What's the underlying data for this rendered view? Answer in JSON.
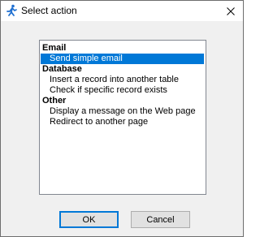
{
  "window": {
    "title": "Select action",
    "icon": "running-figure-icon",
    "close_icon": "close-icon"
  },
  "action_list": {
    "groups": [
      {
        "header": "Email",
        "items": [
          {
            "label": "Send simple email",
            "selected": true
          }
        ]
      },
      {
        "header": "Database",
        "items": [
          {
            "label": "Insert a record into another table",
            "selected": false
          },
          {
            "label": "Check if specific record exists",
            "selected": false
          }
        ]
      },
      {
        "header": "Other",
        "items": [
          {
            "label": "Display a message on the Web page",
            "selected": false
          },
          {
            "label": "Redirect to another page",
            "selected": false
          }
        ]
      }
    ]
  },
  "buttons": {
    "ok_label": "OK",
    "cancel_label": "Cancel"
  },
  "colors": {
    "selection": "#0078d7",
    "default_button_border": "#0078d7"
  }
}
